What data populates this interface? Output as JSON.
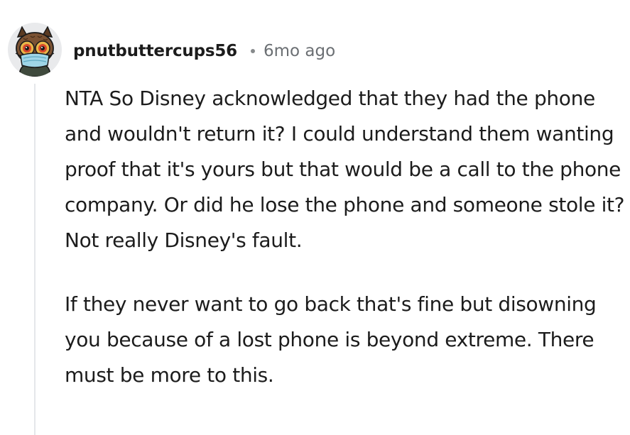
{
  "comment": {
    "author": "pnutbuttercups56",
    "separator": "•",
    "timestamp": "6mo ago",
    "avatar_icon": "owl-with-face-mask-icon",
    "paragraphs": [
      "NTA So Disney acknowledged that they had the phone and wouldn't return it? I could understand them wanting proof that it's yours but that would be a call to the phone company. Or did he lose the phone and someone stole it? Not really Disney's fault.",
      "If they never want to go back that's fine but disowning you because of a lost phone is beyond extreme. There must be more to this."
    ]
  },
  "colors": {
    "text": "#1c1c1c",
    "meta_text": "#6b6f73",
    "thread_line": "#e5e7ea",
    "avatar_bg": "#e9eaec"
  }
}
